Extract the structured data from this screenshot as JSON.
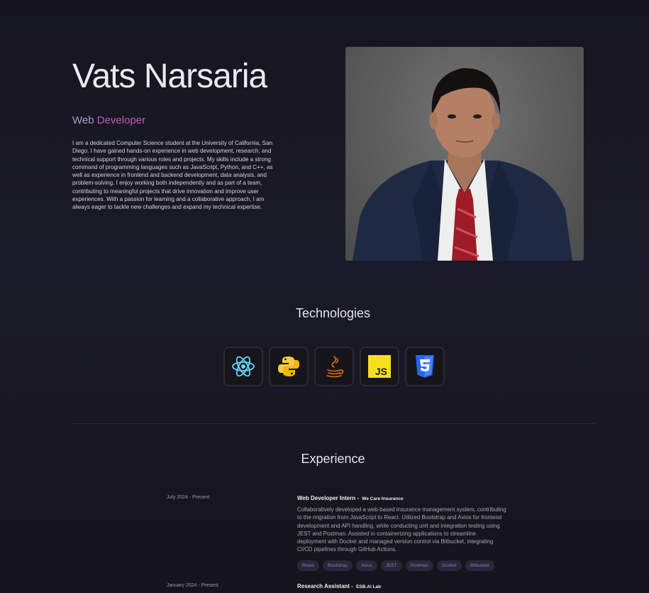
{
  "hero": {
    "name": "Vats Narsaria",
    "role_part1": "Web",
    "role_part2": "Developer",
    "bio": "I am a dedicated Computer Science student at the University of California, San Diego. I have gained hands-on experience in web development, research, and technical support through various roles and projects. My skills include a strong command of programming languages such as JavaScript, Python, and C++, as well as experience in frontend and backend development, data analysis, and problem-solving. I enjoy working both independently and as part of a team, contributing to meaningful projects that drive innovation and improve user experiences. With a passion for learning and a collaborative approach, I am always eager to tackle new challenges and expand my technical expertise."
  },
  "technologies": {
    "title": "Technologies",
    "items": [
      {
        "icon": "react-icon",
        "color": "#61dafb"
      },
      {
        "icon": "python-icon",
        "color": "#f7c948"
      },
      {
        "icon": "java-icon",
        "color": "#e76f00"
      },
      {
        "icon": "javascript-icon",
        "color": "#f7df1e"
      },
      {
        "icon": "css3-icon",
        "color": "#2965f1"
      }
    ]
  },
  "experience": {
    "title": "Experience",
    "entries": [
      {
        "date": "July 2024 - Present",
        "position": "Web Developer Intern - ",
        "company": "We Care Insurance",
        "description": "Collaboratively developed a web-based insurance management system, contributing to the migration from JavaScript to React. Utilized Bootstrap and Axios for frontend development and API handling, while conducting unit and integration testing using JEST and Postman. Assisted in containerizing applications to streamline deployment with Docker and managed version control via Bitbucket, integrating CI/CD pipelines through GitHub Actions.",
        "tags": [
          "React",
          "Bootstrap",
          "Axios",
          "JEST",
          "Postman",
          "Docker",
          "Bitbucket"
        ]
      },
      {
        "date": "January 2024 - Present",
        "position": "Research Assistant - ",
        "company": "ESB.AI Lab"
      }
    ]
  },
  "colors": {
    "background": "#1b1a28",
    "role_web": "#a99ad8",
    "role_developer": "#c15bb6",
    "tag_text": "#8f6fdd"
  }
}
